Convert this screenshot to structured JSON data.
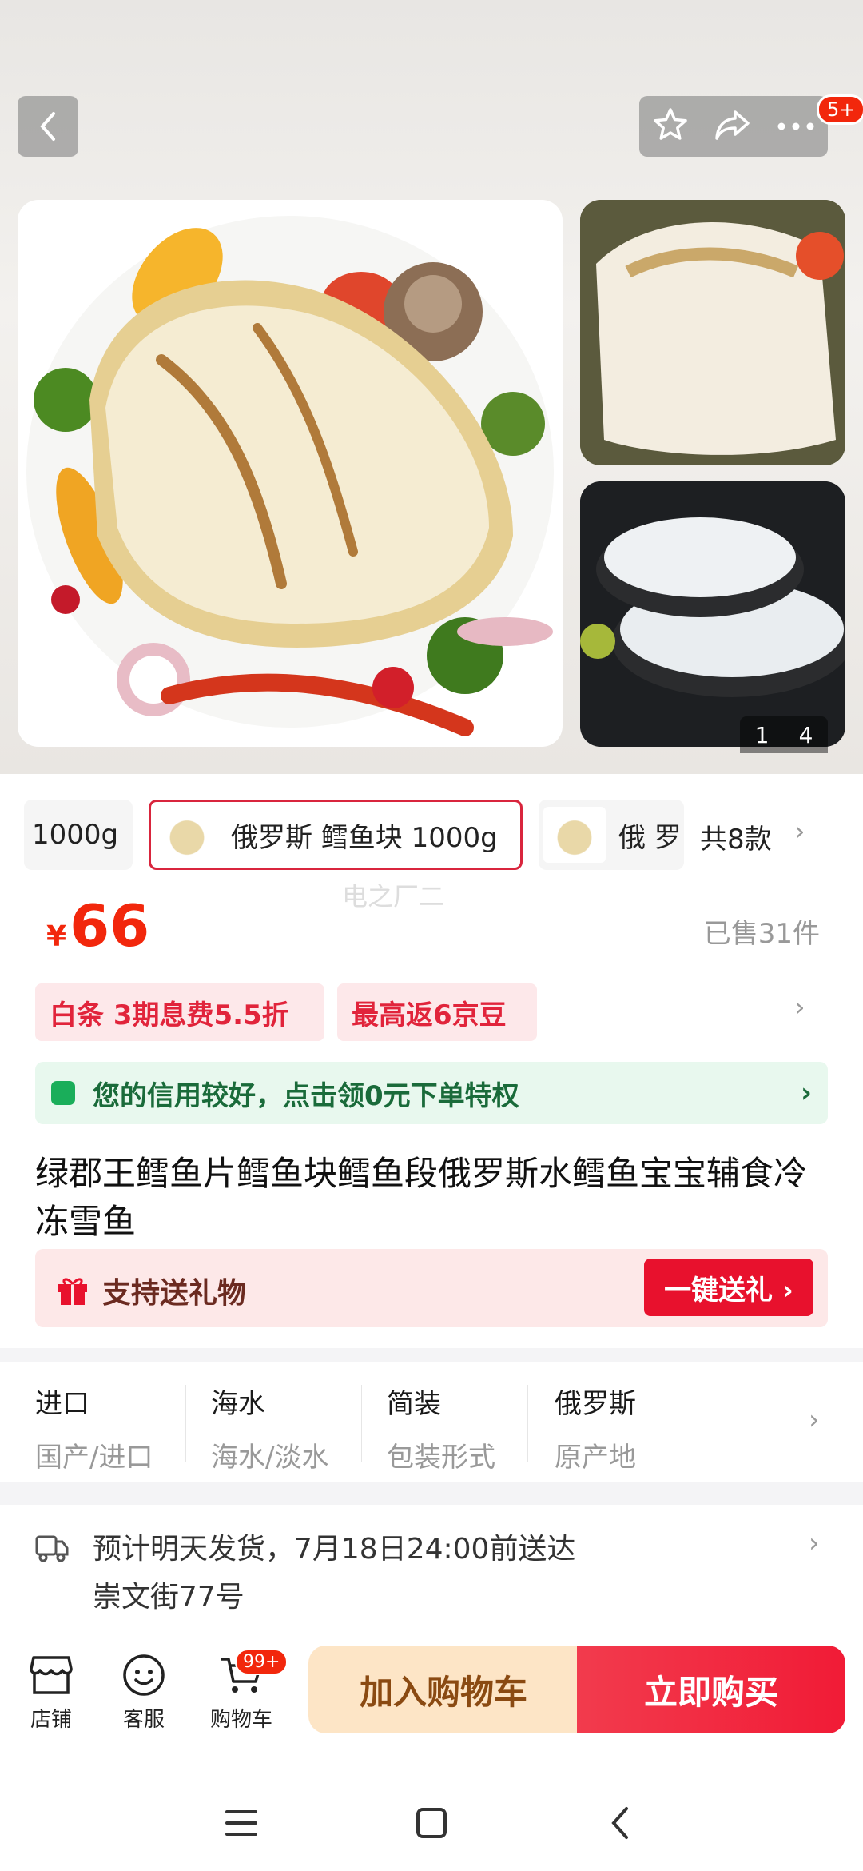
{
  "header": {
    "cart_count_badge": "5+"
  },
  "gallery": {
    "counter_current": "1",
    "counter_total": "4"
  },
  "variants": {
    "items": [
      {
        "label": "1000g"
      },
      {
        "label": "俄罗斯  鳕鱼块 1000g",
        "selected": true
      },
      {
        "label": "俄 罗"
      }
    ],
    "count_label": "共8款"
  },
  "price": {
    "currency": "¥",
    "amount": "66",
    "sold": "已售31件",
    "watermark": "电之厂二"
  },
  "promotions": [
    {
      "label": "白条  3期息费5.5折"
    },
    {
      "label": "最高返6京豆"
    }
  ],
  "credit_banner": {
    "text": "您的信用较好，点击领0元下单特权"
  },
  "product": {
    "title": "绿郡王鳕鱼片鳕鱼块鳕鱼段俄罗斯水鳕鱼宝宝辅食冷冻雪鱼"
  },
  "gift": {
    "label": "支持送礼物",
    "button": "一键送礼 ›"
  },
  "attributes": [
    {
      "value": "进口",
      "key": "国产/进口"
    },
    {
      "value": "海水",
      "key": "海水/淡水"
    },
    {
      "value": "简装",
      "key": "包装形式"
    },
    {
      "value": "俄罗斯",
      "key": "原产地"
    }
  ],
  "delivery": {
    "line1": "预计明天发货，7月18日24:00前送达",
    "line2": "崇文街77号"
  },
  "bottom_bar": {
    "store": "店铺",
    "service": "客服",
    "cart": "购物车",
    "cart_badge": "99+",
    "add_to_cart": "加入购物车",
    "buy_now": "立即购买"
  },
  "colors": {
    "accent_red": "#f2270c",
    "buy_button": "#f11b36",
    "cart_button": "#fde5c6",
    "credit_green": "#1aae5a"
  }
}
